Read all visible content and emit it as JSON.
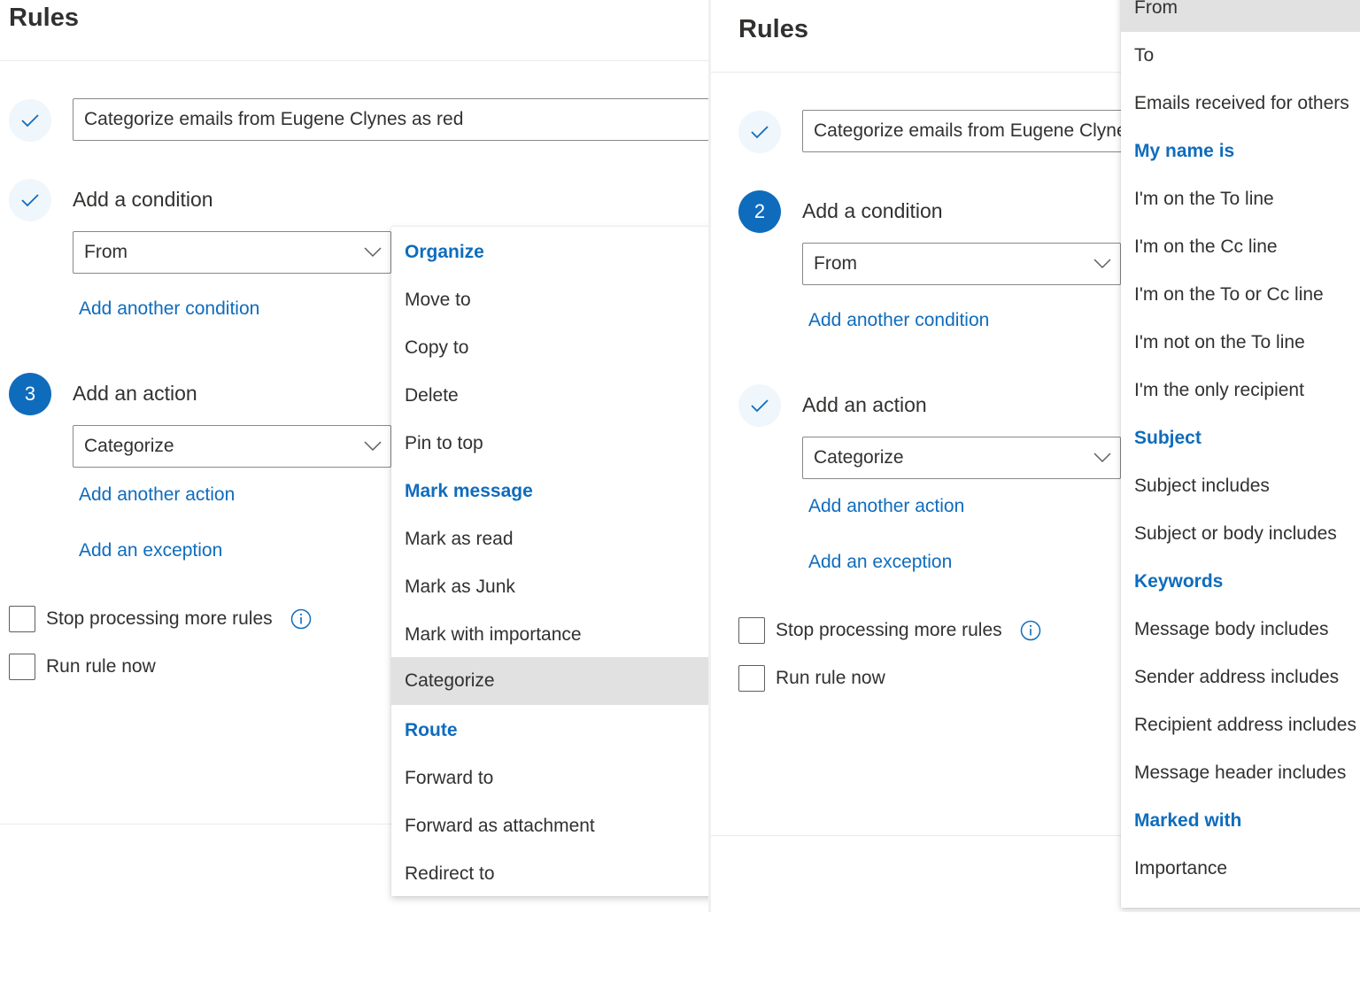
{
  "colors": {
    "accent": "#0f6cbd",
    "text": "#323130",
    "selected_bg": "#e1e1e1",
    "border": "#8a8886"
  },
  "left": {
    "title": "Rules",
    "rule_name": "Categorize emails from Eugene Clynes as red",
    "steps": {
      "name_state": "check-icon",
      "condition_state": "check-icon",
      "action_number": "3"
    },
    "condition": {
      "heading": "Add a condition",
      "selected": "From",
      "add_another": "Add another condition"
    },
    "action": {
      "heading": "Add an action",
      "selected": "Categorize",
      "add_another": "Add another action",
      "add_exception": "Add an exception"
    },
    "options": {
      "stop_processing": "Stop processing more rules",
      "run_now": "Run rule now"
    },
    "menu": {
      "organize_header": "Organize",
      "move_to": "Move to",
      "copy_to": "Copy to",
      "delete": "Delete",
      "pin_to_top": "Pin to top",
      "mark_header": "Mark message",
      "mark_read": "Mark as read",
      "mark_junk": "Mark as Junk",
      "mark_importance": "Mark with importance",
      "categorize": "Categorize",
      "route_header": "Route",
      "forward_to": "Forward to",
      "forward_attachment": "Forward as attachment",
      "redirect_to": "Redirect to",
      "selected_item": "Categorize"
    }
  },
  "right": {
    "title": "Rules",
    "rule_name": "Categorize emails from Eugene Clynes as red",
    "steps": {
      "name_state": "check-icon",
      "condition_number": "2",
      "action_state": "check-icon"
    },
    "condition": {
      "heading": "Add a condition",
      "selected": "From",
      "add_another": "Add another condition"
    },
    "action": {
      "heading": "Add an action",
      "selected": "Categorize",
      "add_another": "Add another action",
      "add_exception": "Add an exception"
    },
    "options": {
      "stop_processing": "Stop processing more rules",
      "run_now": "Run rule now"
    },
    "menu": {
      "from": "From",
      "to": "To",
      "received_for_others": "Emails received for others",
      "my_name_header": "My name is",
      "on_to_line": "I'm on the To line",
      "on_cc_line": "I'm on the Cc line",
      "on_to_or_cc": "I'm on the To or Cc line",
      "not_on_to": "I'm not on the To line",
      "only_recipient": "I'm the only recipient",
      "subject_header": "Subject",
      "subject_includes": "Subject includes",
      "subject_or_body": "Subject or body includes",
      "keywords_header": "Keywords",
      "body_includes": "Message body includes",
      "sender_includes": "Sender address includes",
      "recipient_includes": "Recipient address includes",
      "header_includes": "Message header includes",
      "marked_header": "Marked with",
      "importance": "Importance",
      "selected_item": "From"
    }
  }
}
